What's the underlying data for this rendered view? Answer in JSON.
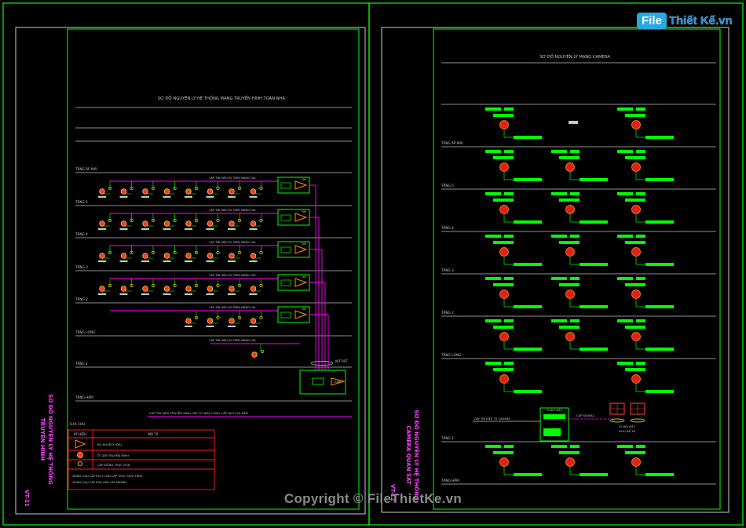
{
  "watermark": {
    "logo_box": "File",
    "logo_rest": "Thiết Kế.vn",
    "copyright": "Copyright © FileThietKe.vn"
  },
  "left_sheet": {
    "title": "SƠ ĐỒ NGUYÊN LÝ HỆ THỐNG MẠNG TRUYỀN HÌNH TOÀN NHÀ",
    "vertical_title_1": "SƠ ĐỒ NGUYÊN LÝ HỆ THỐNG",
    "vertical_title_2": "TRUYỀN HÌNH",
    "sheet_code": "VT-11",
    "floors": [
      "TẦNG ÁP MÁI",
      "TẦNG 5",
      "TẦNG 4",
      "TẦNG 3",
      "TẦNG 2",
      "TẦNG LỬNG",
      "TẦNG 1",
      "TẦNG HẦM"
    ],
    "trunk_label": "CÁP TÍN HIỆU ĐI TRÊN MÁNG GIA",
    "box_label": "TAP",
    "amp_label": "AMP",
    "riser_label": "N/T RST",
    "bottom_note": "CÁP TÍN HIỆU TRUYỀN HÌNH CÁP TỪ NHÀ CUNG CẤP DỊCH VỤ ĐẾN",
    "legend": {
      "title": "GHI CHÚ",
      "col_symbol": "KÝ HIỆU",
      "col_desc": "MÔ TẢ",
      "rows": [
        "BỘ KHUẾCH ĐẠI",
        "Ổ CẮM TRUYỀN HÌNH",
        "CÁP ĐỒNG TRỤC RG6"
      ],
      "notes": [
        "- DÙNG LOẠI CÁP RG11 LÀM CÁP TRỤC GIỮA TẦNG",
        "- DÙNG LOẠI CÁP RG6 LÀM CÁP NHÁNH"
      ]
    }
  },
  "right_sheet": {
    "title": "SƠ ĐỒ NGUYÊN LÝ MẠNG CAMERA",
    "vertical_title_1": "SƠ ĐỒ NGUYÊN LÝ HỆ THỐNG",
    "vertical_title_2": "CAMERA QUAN SÁT",
    "sheet_code": "VT-12",
    "floors": [
      "TẦNG ÁP MÁI",
      "TẦNG 5",
      "TẦNG 4",
      "TẦNG 3",
      "TẦNG 2",
      "TẦNG LỬNG",
      "TẦNG 1",
      "TẦNG HẦM"
    ],
    "control_room": "P.LÀM VIỆC",
    "control_room_2": "P.LÀM VIỆC",
    "control_sub": "KHU ĐỂ XE",
    "cable_label": "CÁP SIGNAL",
    "cable_note": "DÂY TÍN HIỆU TỪ CAMERA"
  },
  "colors": {
    "frame": "#00ff00",
    "trunk": "#ff00ff",
    "box": "#00ff00",
    "amplifier": "#ff8c00",
    "outlet": "#ff3333",
    "camera": "#e0201c",
    "lines": "#bfbfbf",
    "label": "#c8c8c8"
  },
  "icons": [
    "amplifier-icon",
    "tv-outlet-icon",
    "camera-icon",
    "monitor-icon"
  ]
}
